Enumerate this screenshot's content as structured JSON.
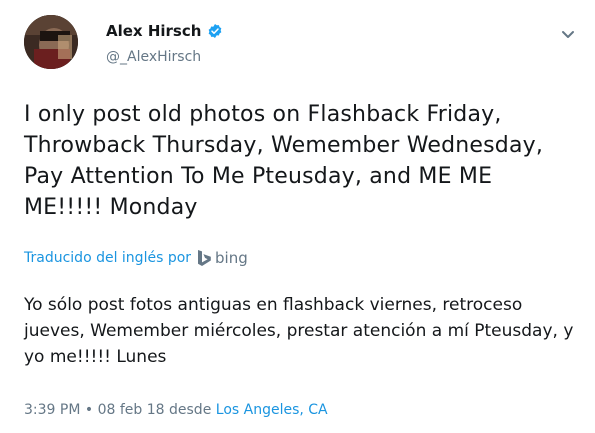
{
  "author": {
    "name": "Alex Hirsch",
    "handle": "@_AlexHirsch",
    "verified": true
  },
  "tweet": {
    "text_original": "I only post old photos on Flashback Friday, Throwback Thursday, Wemember Wednesday, Pay Attention To Me Pteusday, and ME ME ME!!!!! Monday",
    "translated_label": "Traducido del inglés por",
    "translator": "bing",
    "text_translated": "Yo sólo post fotos antiguas en flashback viernes, retroceso jueves, Wemember miércoles, prestar atención a mí Pteusday, y yo me!!!!! Lunes",
    "time": "3:39 PM",
    "separator": "•",
    "date": "08 feb 18",
    "from_label": "desde",
    "location": "Los Angeles, CA"
  },
  "icons": {
    "verified": "verified-badge-icon",
    "menu": "chevron-down-icon",
    "translator_logo": "bing-logo-icon"
  },
  "colors": {
    "accent": "#1b95e0",
    "secondary_text": "#657786",
    "primary_text": "#14171a"
  }
}
